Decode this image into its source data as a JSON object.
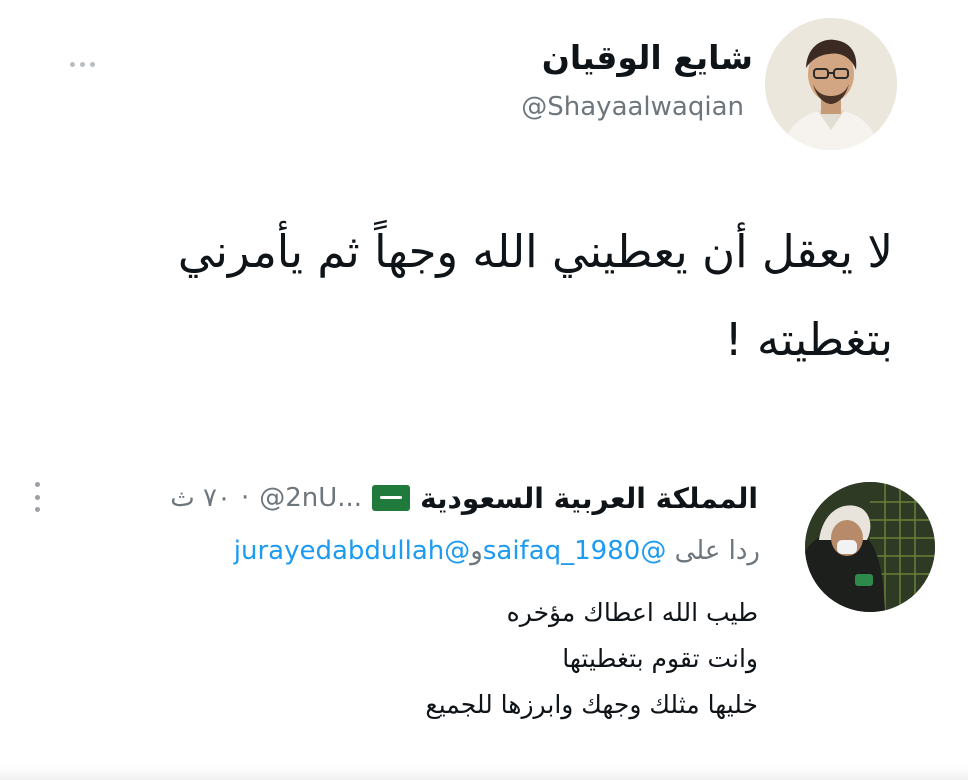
{
  "main_tweet": {
    "name": "شايع الوقيان",
    "handle": "@Shayaalwaqian",
    "text_lines": [
      "لا يعقل أن يعطيني الله وجهاً ثم يأمرني",
      "بتغطيته !"
    ],
    "avatar_icon": "profile-photo-man-icon",
    "more_icon": "more-horizontal-icon"
  },
  "reply": {
    "name": "المملكة العربية السعودية",
    "flag_icon": "saudi-flag-icon",
    "handle": "@2nU...",
    "separator": "·",
    "time": "٧٠ ث",
    "reply_prefix": "ردا على",
    "mention_1": "@saifaq_1980",
    "conjunction": "و",
    "mention_2": "@jurayedabdullah",
    "body_lines": [
      "طيب الله اعطاك مؤخره",
      "وانت تقوم بتغطيتها",
      "خليها مثلك وجهك وابرزها للجميع"
    ],
    "avatar_icon": "profile-photo-masked-man-icon",
    "more_icon": "more-vertical-icon"
  },
  "colors": {
    "text": "#0f1419",
    "secondary": "#6e767d",
    "link": "#1d9bf0",
    "flag_green": "#1f7a3c"
  }
}
